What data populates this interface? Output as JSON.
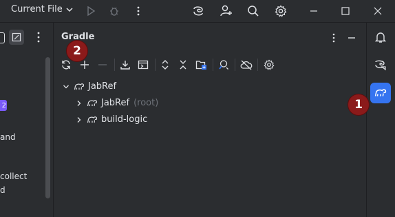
{
  "titlebar": {
    "run_config_label": "Current File",
    "icons": [
      "chevron-down-icon",
      "run-icon",
      "debug-icon",
      "more-vertical-icon",
      "ai-assistant-icon",
      "add-user-icon",
      "search-icon",
      "settings-icon",
      "minimize-icon",
      "maximize-icon",
      "close-icon"
    ]
  },
  "left_panel": {
    "badge_text": "2",
    "text_lines": [
      "and",
      "collect",
      "d"
    ]
  },
  "gradle": {
    "title": "Gradle",
    "toolbar_icons": [
      "reload-icon",
      "add-icon",
      "remove-icon",
      "download-icon",
      "execute-task-icon",
      "expand-all-icon",
      "collapse-all-icon",
      "dependencies-icon",
      "analyze-icon",
      "offline-mode-icon",
      "gradle-settings-icon"
    ],
    "tree": [
      {
        "label": "JabRef",
        "suffix": "",
        "expanded": true
      },
      {
        "label": "JabRef",
        "suffix": "(root)",
        "expanded": false
      },
      {
        "label": "build-logic",
        "suffix": "",
        "expanded": false
      }
    ]
  },
  "right_strip": {
    "icons": [
      "notifications-icon",
      "ai-chat-icon",
      "gradle-elephant-icon"
    ]
  },
  "annotations": {
    "badge_1": "1",
    "badge_2": "2"
  },
  "colors": {
    "accent": "#3574f0",
    "badge": "#8b1a1a",
    "panel": "#2b2d30",
    "background": "#1e1f22"
  }
}
